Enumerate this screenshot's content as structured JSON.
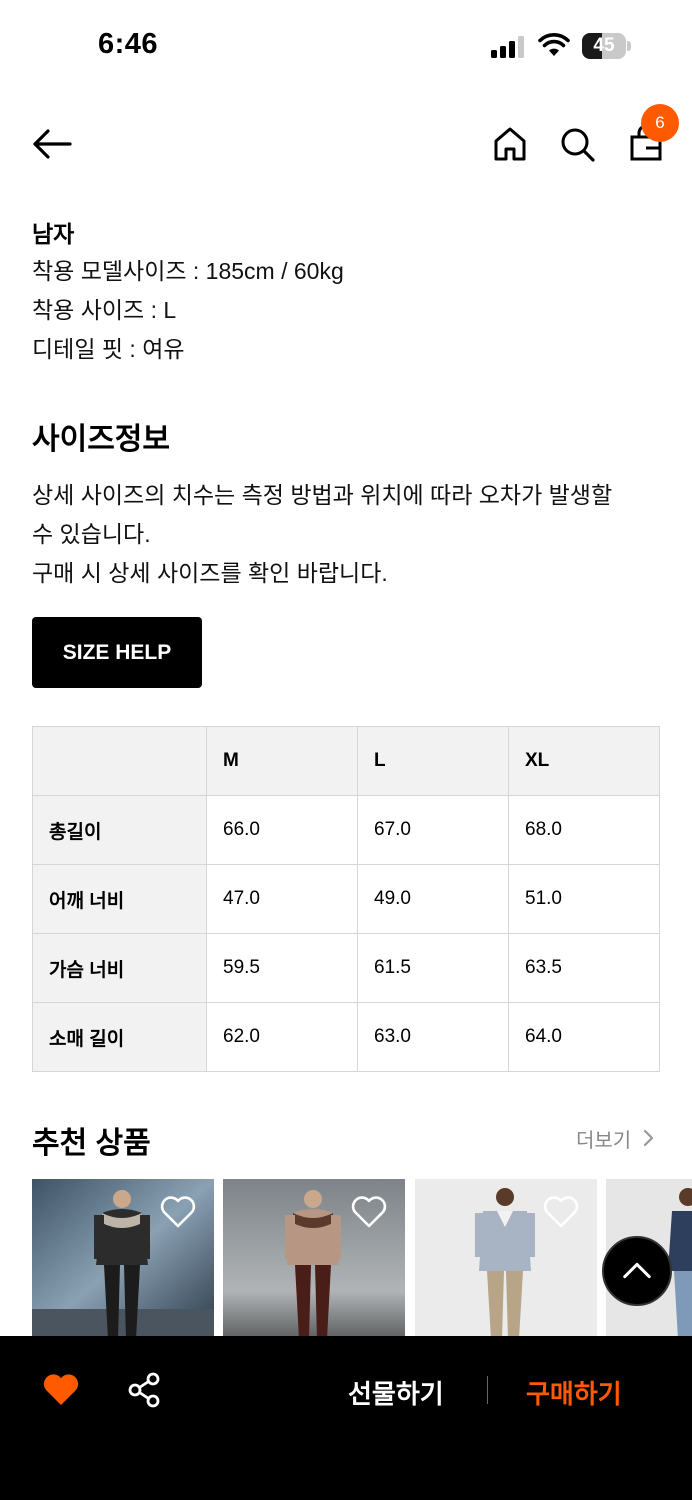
{
  "status_bar": {
    "time": "6:46",
    "battery": "45",
    "battery_level": 0.45
  },
  "nav": {
    "cart_count": "6"
  },
  "model": {
    "gender": "남자",
    "lines": [
      "착용 모델사이즈 : 185cm / 60kg",
      "착용 사이즈 : L",
      "디테일 핏 : 여유"
    ]
  },
  "size_info": {
    "title": "사이즈정보",
    "description_lines": [
      "상세 사이즈의 치수는 측정 방법과 위치에 따라 오차가 발생할",
      "수 있습니다.",
      "구매 시 상세 사이즈를 확인 바랍니다."
    ],
    "help_button": "SIZE HELP"
  },
  "size_table": {
    "columns": [
      "",
      "M",
      "L",
      "XL"
    ],
    "rows": [
      {
        "label": "총길이",
        "values": [
          "66.0",
          "67.0",
          "68.0"
        ]
      },
      {
        "label": "어깨 너비",
        "values": [
          "47.0",
          "49.0",
          "51.0"
        ]
      },
      {
        "label": "가슴 너비",
        "values": [
          "59.5",
          "61.5",
          "63.5"
        ]
      },
      {
        "label": "소매 길이",
        "values": [
          "62.0",
          "63.0",
          "64.0"
        ]
      }
    ]
  },
  "recommended": {
    "title": "추천 상품",
    "more_label": "더보기"
  },
  "bottom_bar": {
    "gift_label": "선물하기",
    "buy_label": "구매하기"
  },
  "colors": {
    "accent": "#ff5a00",
    "dark": "#000000",
    "table_header_bg": "#f2f2f2"
  }
}
